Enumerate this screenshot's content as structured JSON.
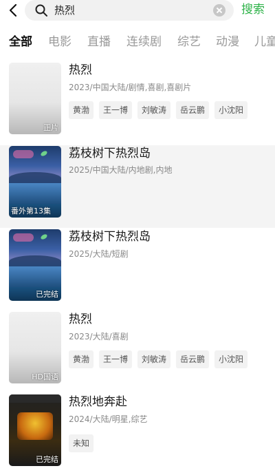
{
  "search": {
    "query": "热烈",
    "button_label": "搜索"
  },
  "tabs": [
    "全部",
    "电影",
    "直播",
    "连续剧",
    "综艺",
    "动漫",
    "儿童"
  ],
  "results": [
    {
      "title": "热烈",
      "meta": "2023/中国大陆/剧情,喜剧,喜剧片",
      "badge": "正片",
      "tags": [
        "黄渤",
        "王一博",
        "刘敏涛",
        "岳云鹏",
        "小沈阳"
      ]
    },
    {
      "title": "荔枝树下热烈岛",
      "meta": "2025/中国大陆/内地剧,内地",
      "badge": "番外第13集",
      "tags": []
    },
    {
      "title": "荔枝树下热烈岛",
      "meta": "2025/大陆/短剧",
      "badge": "已完结",
      "tags": []
    },
    {
      "title": "热烈",
      "meta": "2023/大陆/喜剧",
      "badge": "HD国语",
      "tags": [
        "黄渤",
        "王一博",
        "刘敏涛",
        "岳云鹏",
        "小沈阳"
      ]
    },
    {
      "title": "热烈地奔赴",
      "meta": "2024/大陆/明星,综艺",
      "badge": "已完结",
      "tags": [
        "未知"
      ]
    }
  ],
  "colors": {
    "accent": "#2fb34a",
    "tab_inactive": "#9a9a9a",
    "highlight_row": "#f4f4f4"
  }
}
